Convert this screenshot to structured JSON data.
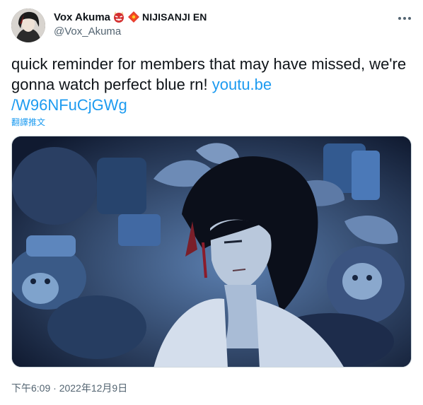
{
  "tweet": {
    "display_name": "Vox Akuma",
    "affiliation": "NIJISANJI EN",
    "handle": "@Vox_Akuma",
    "text_plain": "quick reminder for members that may have missed, we're gonna watch perfect blue rn! ",
    "link_part1": "youtu.be",
    "link_part2": "/W96NFuCjGWg",
    "translate_label": "翻譯推文",
    "timestamp": "下午6:09 · 2022年12月9日",
    "media_alt": "Illustration of a dark-haired character lying among plushies and leaves in blue light"
  },
  "icons": {
    "more": "more-horizontal-icon",
    "emoji1": "oni-mask-emoji",
    "emoji2": "red-envelope-emoji"
  },
  "colors": {
    "link": "#1d9bf0",
    "text": "#0f1419",
    "secondary": "#536471"
  }
}
